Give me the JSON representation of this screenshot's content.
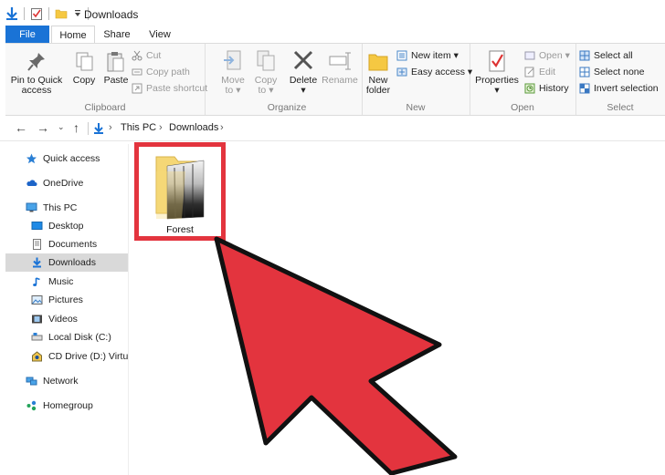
{
  "window": {
    "title": "Downloads"
  },
  "tabs": [
    {
      "label": "File"
    },
    {
      "label": "Home"
    },
    {
      "label": "Share"
    },
    {
      "label": "View"
    }
  ],
  "ribbon": {
    "clipboard": {
      "label": "Clipboard",
      "pin_label_1": "Pin to Quick",
      "pin_label_2": "access",
      "copy_label": "Copy",
      "paste_label": "Paste",
      "cut_label": "Cut",
      "copy_path_label": "Copy path",
      "paste_shortcut_label": "Paste shortcut"
    },
    "organize": {
      "label": "Organize",
      "move_to_label_1": "Move",
      "move_to_label_2": "to",
      "copy_to_label_1": "Copy",
      "copy_to_label_2": "to",
      "delete_label": "Delete",
      "rename_label": "Rename"
    },
    "new": {
      "label": "New",
      "new_folder_label_1": "New",
      "new_folder_label_2": "folder",
      "new_item_label": "New item",
      "easy_access_label": "Easy access"
    },
    "open": {
      "label": "Open",
      "properties_label": "Properties",
      "open_label": "Open",
      "edit_label": "Edit",
      "history_label": "History"
    },
    "select": {
      "label": "Select",
      "select_all_label": "Select all",
      "select_none_label": "Select none",
      "invert_selection_label": "Invert selection"
    }
  },
  "address": {
    "crumbs": [
      "This PC",
      "Downloads"
    ]
  },
  "sidebar": {
    "items": [
      {
        "label": "Quick access",
        "icon": "star-icon"
      },
      {
        "label": "OneDrive",
        "icon": "cloud-icon"
      },
      {
        "label": "This PC",
        "icon": "computer-icon"
      },
      {
        "label": "Desktop",
        "icon": "desktop-icon"
      },
      {
        "label": "Documents",
        "icon": "documents-icon"
      },
      {
        "label": "Downloads",
        "icon": "download-icon"
      },
      {
        "label": "Music",
        "icon": "music-icon"
      },
      {
        "label": "Pictures",
        "icon": "pictures-icon"
      },
      {
        "label": "Videos",
        "icon": "videos-icon"
      },
      {
        "label": "Local Disk (C:)",
        "icon": "disk-icon"
      },
      {
        "label": "CD Drive (D:) Virtua",
        "icon": "cd-drive-icon"
      },
      {
        "label": "Network",
        "icon": "network-icon"
      },
      {
        "label": "Homegroup",
        "icon": "homegroup-icon"
      }
    ],
    "selected": "Downloads"
  },
  "content": {
    "folder_name": "Forest"
  },
  "colors": {
    "accent": "#1a73d6",
    "highlight": "#e3343e",
    "arrow_fill": "#e3343e",
    "folder": "#f5d776"
  }
}
